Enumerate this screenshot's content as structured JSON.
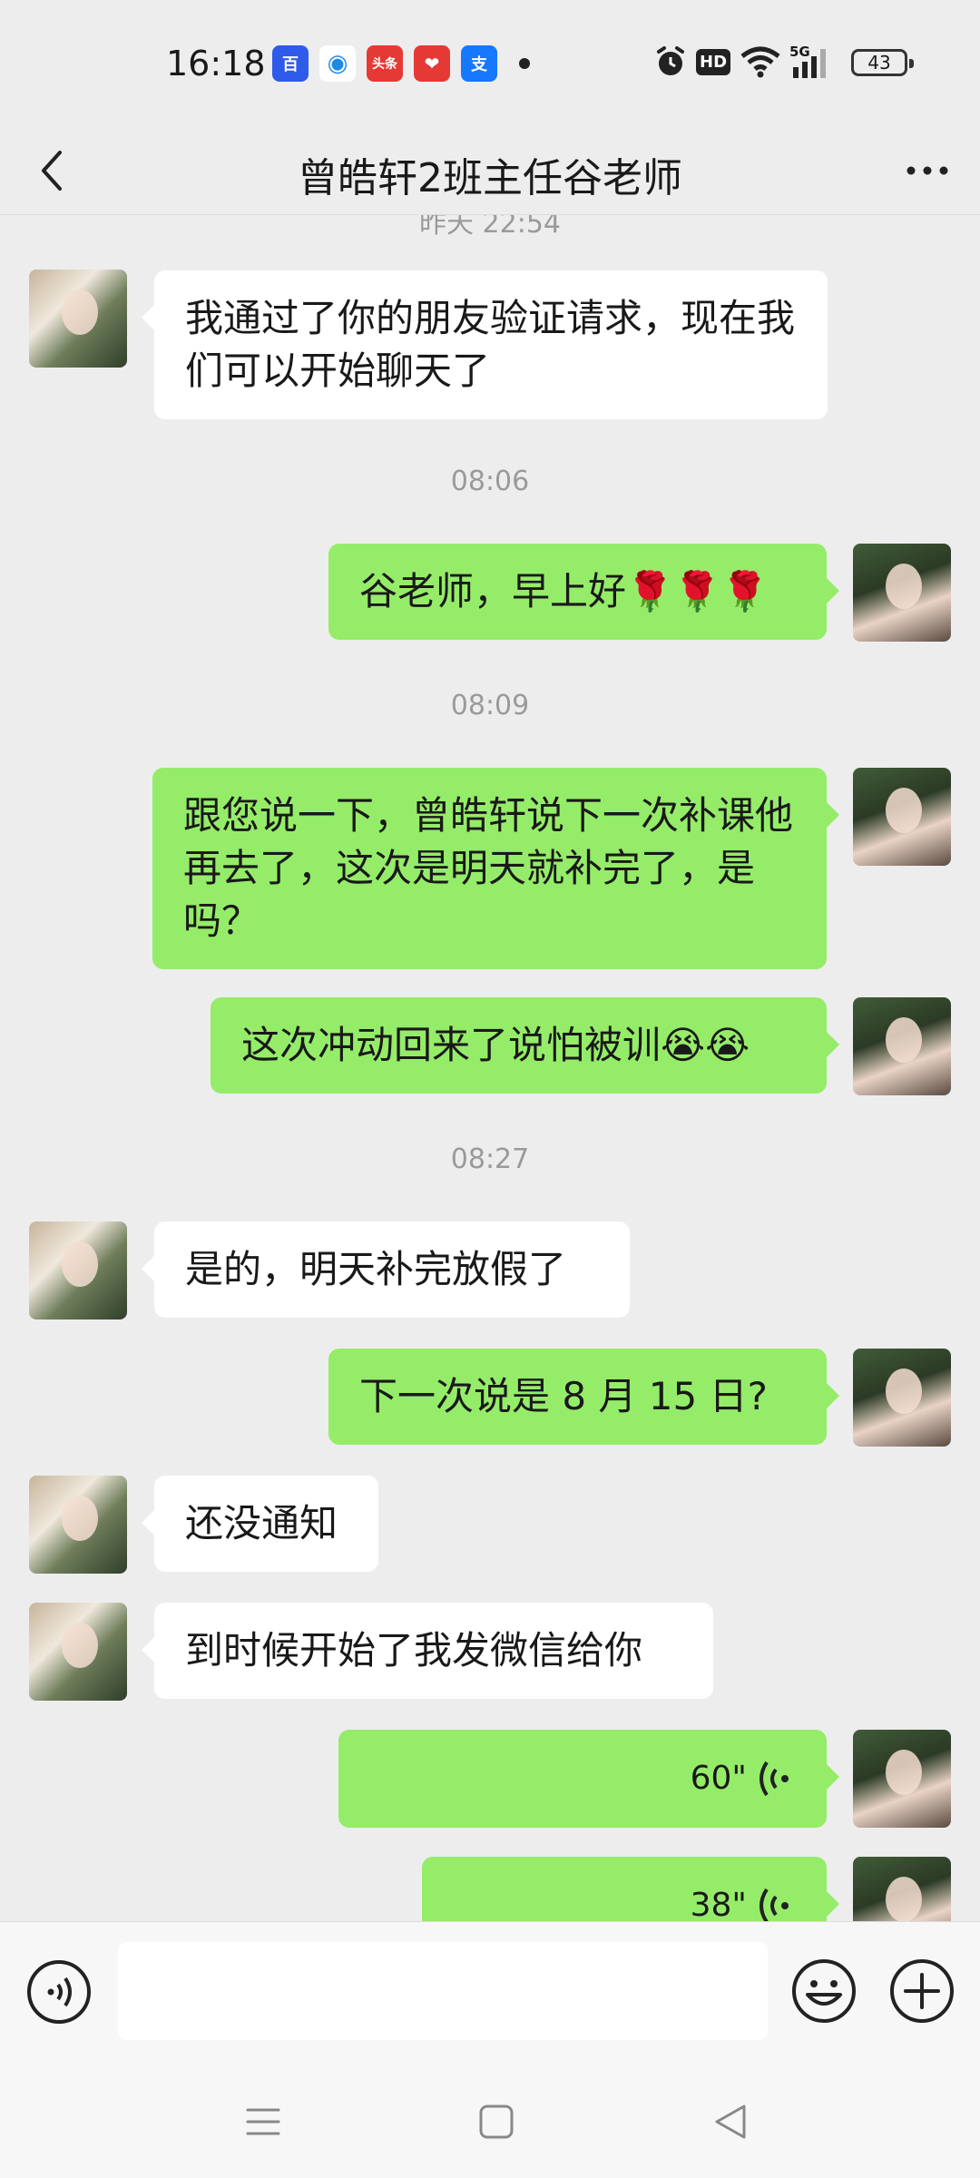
{
  "status_bar": {
    "time": "16:18",
    "app_icons": [
      {
        "name": "baidu-app-icon",
        "color": "#2f5bea",
        "glyph": "百"
      },
      {
        "name": "browser-app-icon",
        "color": "#1e88e5",
        "glyph": "◉"
      },
      {
        "name": "toutiao-app-icon",
        "color": "#e53935",
        "glyph": "头条"
      },
      {
        "name": "heart-app-icon",
        "color": "#e53935",
        "glyph": "❤"
      },
      {
        "name": "alipay-app-icon",
        "color": "#1677ff",
        "glyph": "支"
      }
    ],
    "hd_label": "HD",
    "network_label": "5G",
    "battery": "43"
  },
  "nav": {
    "title": "曾皓轩2班主任谷老师"
  },
  "chat": {
    "partial_timestamp": "昨天 22:54",
    "messages": [
      {
        "kind": "bubble",
        "side": "left",
        "text": "我通过了你的朋友验证请求，现在我们可以开始聊天了"
      },
      {
        "kind": "time",
        "text": "08:06"
      },
      {
        "kind": "bubble",
        "side": "right",
        "text": "谷老师，早上好🌹🌹🌹"
      },
      {
        "kind": "time",
        "text": "08:09"
      },
      {
        "kind": "bubble",
        "side": "right",
        "text": "跟您说一下，曾皓轩说下一次补课他再去了，这次是明天就补完了，是吗？"
      },
      {
        "kind": "bubble",
        "side": "right",
        "text": "这次冲动回来了说怕被训😭😭"
      },
      {
        "kind": "time",
        "text": "08:27"
      },
      {
        "kind": "bubble",
        "side": "left",
        "text": "是的，明天补完放假了"
      },
      {
        "kind": "bubble",
        "side": "right",
        "text": "下一次说是 8 月 15 日?"
      },
      {
        "kind": "bubble",
        "side": "left",
        "text": "还没通知"
      },
      {
        "kind": "bubble",
        "side": "left",
        "text": "到时候开始了我发微信给你"
      },
      {
        "kind": "voice",
        "side": "right",
        "text": "60\""
      },
      {
        "kind": "voice",
        "side": "right",
        "text": "38\""
      }
    ]
  },
  "input_bar": {
    "placeholder": ""
  },
  "colors": {
    "background": "#ededed",
    "my_bubble": "#95ec69",
    "their_bubble": "#ffffff",
    "timestamp_text": "#9a9a9a"
  }
}
